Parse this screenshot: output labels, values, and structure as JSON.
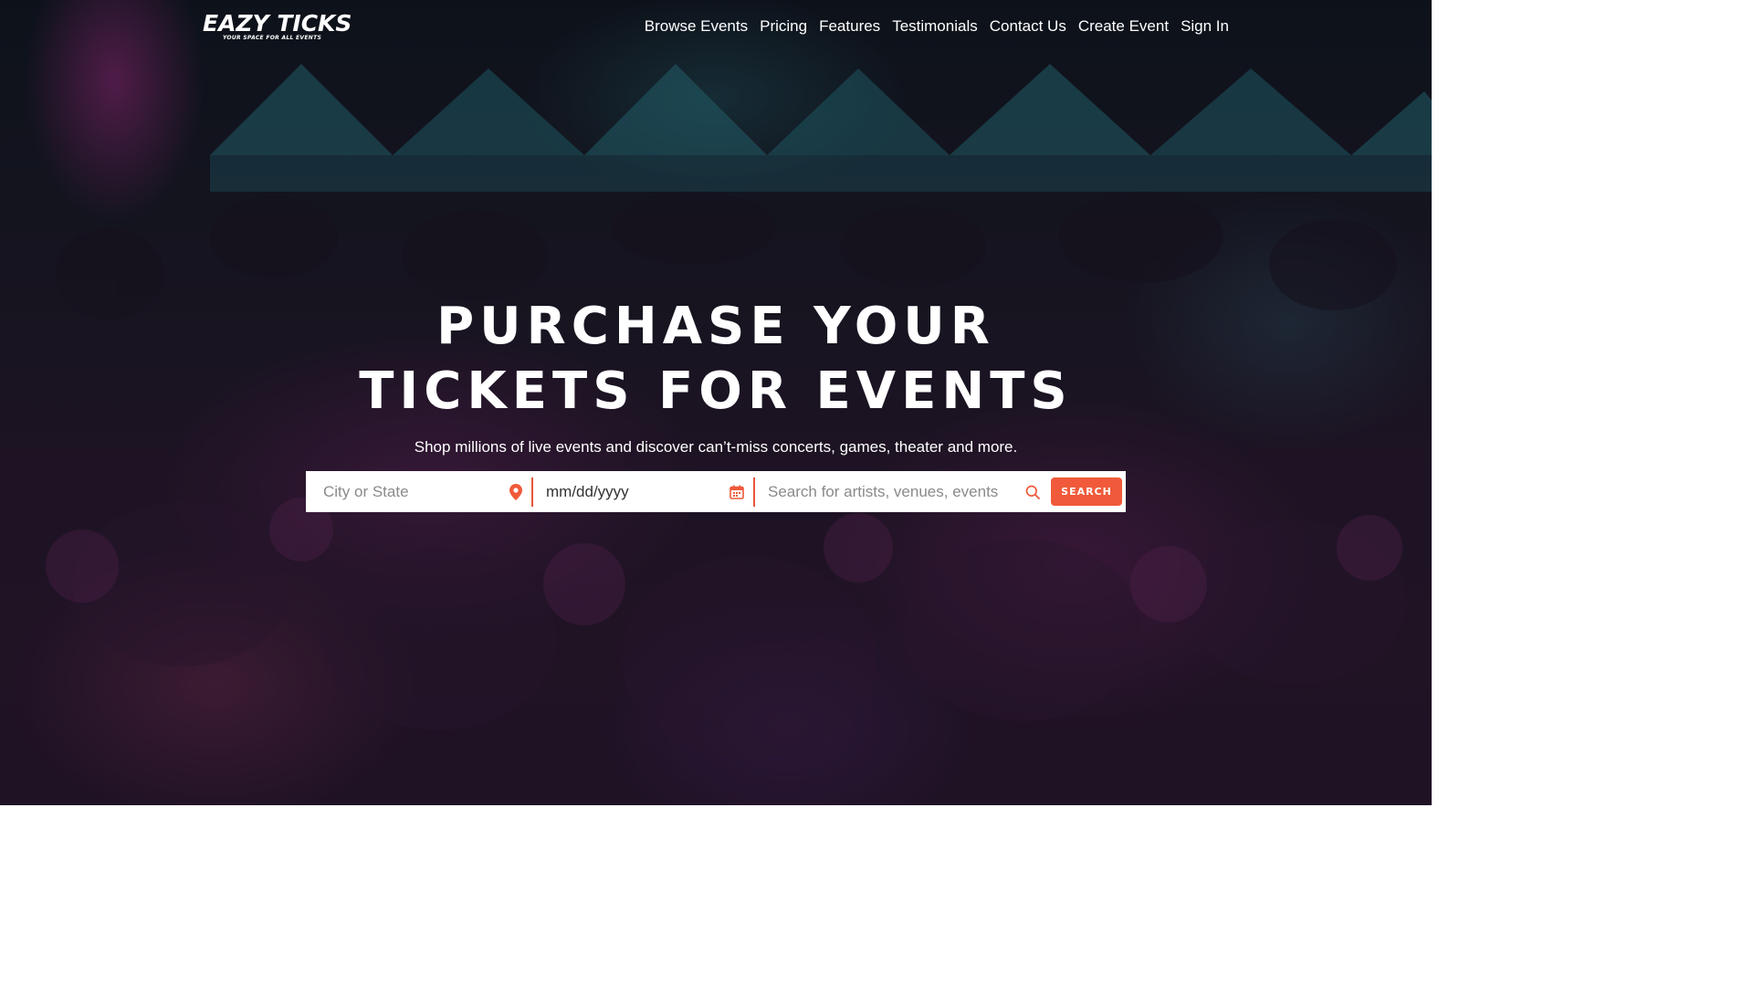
{
  "brand": {
    "name": "EAZY TICKS",
    "tagline": "YOUR SPACE FOR ALL EVENTS"
  },
  "nav": {
    "items": [
      {
        "label": "Browse Events"
      },
      {
        "label": "Pricing"
      },
      {
        "label": "Features"
      },
      {
        "label": "Testimonials"
      },
      {
        "label": "Contact Us"
      },
      {
        "label": "Create Event"
      },
      {
        "label": "Sign In"
      }
    ]
  },
  "hero": {
    "headline_line1": "PURCHASE YOUR",
    "headline_line2": "TICKETS FOR EVENTS",
    "subtitle": "Shop millions of live events and discover can’t-miss concerts, games, theater and more."
  },
  "search": {
    "location_placeholder": "City or State",
    "date_placeholder": "mm/dd/yyyy",
    "query_placeholder": "Search for artists, venues, events",
    "button_label": "SEARCH",
    "icons": {
      "location": "map-pin-icon",
      "date": "calendar-icon",
      "query": "search-icon"
    }
  },
  "colors": {
    "accent": "#f05a3a",
    "divider": "#e8553a",
    "text_light": "#ffffff"
  }
}
